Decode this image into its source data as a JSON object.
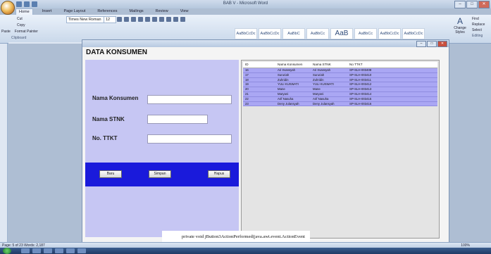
{
  "word": {
    "doc_title": "BAB V - Microsoft Word",
    "tabs": [
      "Home",
      "Insert",
      "Page Layout",
      "References",
      "Mailings",
      "Review",
      "View"
    ],
    "active_tab": "Home",
    "clipboard": {
      "cut": "Cut",
      "copy": "Copy",
      "paste": "Paste",
      "format_painter": "Format Painter",
      "group_label": "Clipboard"
    },
    "font_name": "Times New Roman",
    "font_size": "12",
    "styles": [
      "AaBbCcDc",
      "AaBbCcDc",
      "AaBbC",
      "AaBbCc",
      "AaB",
      "AaBbCc",
      "AaBbCcDc",
      "AaBbCcDc"
    ],
    "change_styles": "Change Styles",
    "editing": {
      "find": "Find",
      "replace": "Replace",
      "select": "Select",
      "label": "Editing"
    },
    "status": "Page: 5 of 23   Words: 2,187",
    "zoom": "100%"
  },
  "app": {
    "title": "DATA KONSUMEN",
    "labels": {
      "nama_konsumen": "Nama Konsumen",
      "nama_stnk": "Nama STNK",
      "no_ttkt": "No. TTKT"
    },
    "values": {
      "nama_konsumen": "",
      "nama_stnk": "",
      "no_ttkt": ""
    },
    "buttons": {
      "baru": "Baru",
      "simpan": "Simpan",
      "hapus": "Hapus"
    },
    "table": {
      "headers": [
        "ID",
        "Nama Konsumen",
        "Nama STNK",
        "No TTKT"
      ],
      "rows": [
        [
          "16",
          "Ari Irvansyah",
          "Ari Irvansyah",
          "SP-SLH-003408"
        ],
        [
          "17",
          "Sururiah",
          "Sururiah",
          "SP-SLH-003410"
        ],
        [
          "18",
          "Zuhridin",
          "Zuhridin",
          "SP-SLH-003411"
        ],
        [
          "19",
          "YULI KUSWATI",
          "YULI KUSWATI",
          "SP-SLH-003412"
        ],
        [
          "20",
          "Mane",
          "Mane",
          "SP-SLH-003413"
        ],
        [
          "21",
          "Maryani",
          "Maryani",
          "SP-SLH-003414"
        ],
        [
          "22",
          "Arif Nasuha",
          "Arif Nasuha",
          "SP-SLH-003415"
        ],
        [
          "23",
          "Deny Julansyah",
          "Deny Julansyah",
          "SP-SLH-003416"
        ]
      ]
    }
  },
  "code_line": "private void jButton3ActionPerformed(java.awt.event.ActionEvent",
  "colors": {
    "form_bg": "#c6c6f3",
    "button_bar": "#1a1adb",
    "row_bg": "#aaa7f4"
  }
}
